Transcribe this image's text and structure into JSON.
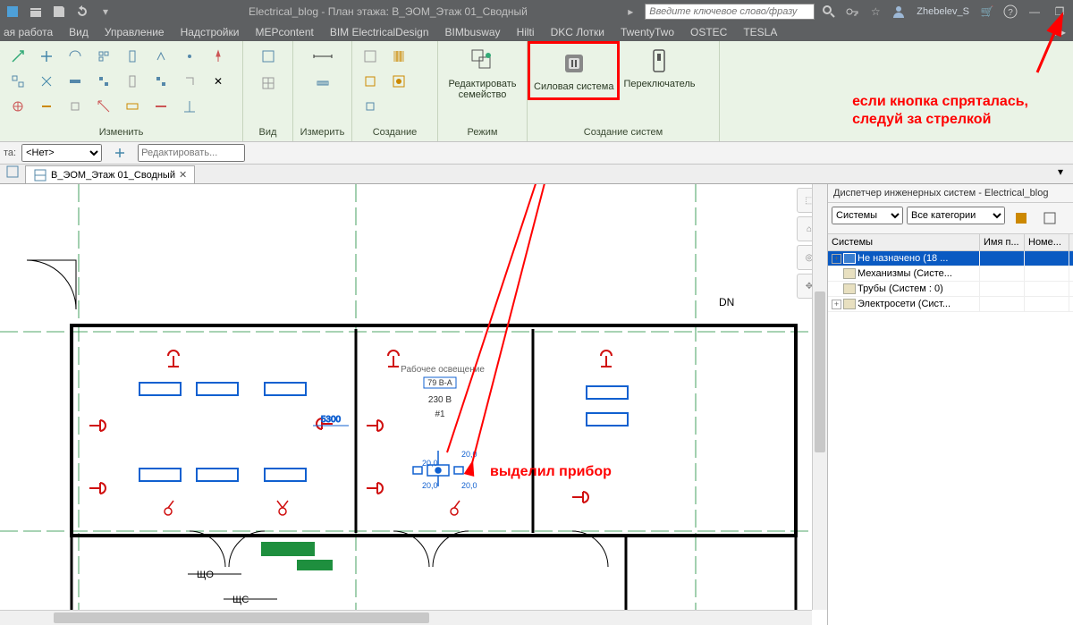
{
  "titlebar": {
    "title": "Electrical_blog - План этажа: В_ЭОМ_Этаж 01_Сводный",
    "search_placeholder": "Введите ключевое слово/фразу",
    "user": "Zhebelev_S"
  },
  "menu": {
    "items": [
      "ая работа",
      "Вид",
      "Управление",
      "Надстройки",
      "MEPcontent",
      "BIM ElectricalDesign",
      "BIMbusway",
      "Hilti",
      "DKC Лотки",
      "TwentyTwo",
      "OSTEC",
      "TESLA"
    ]
  },
  "ribbon": {
    "panels": {
      "modify": "Изменить",
      "view": "Вид",
      "measure": "Измерить",
      "create": "Создание",
      "mode": "Режим",
      "systems": "Создание систем"
    },
    "buttons": {
      "edit_family": "Редактировать\nсемейство",
      "power_system": "Силовая система",
      "switch": "Переключатель"
    }
  },
  "opt": {
    "label1": "та:",
    "select_value": "<Нет>",
    "placeholder": "Редактировать..."
  },
  "viewtab": {
    "name": "В_ЭОМ_Этаж 01_Сводный"
  },
  "canvas": {
    "room_label": "Рабочее освещение",
    "lbl_va": "79 В-А",
    "lbl_volt": "230 В",
    "lbl_num": "#1",
    "dim_5300": "5300",
    "val_200_a": "20,0",
    "val_200_b": "20,0",
    "val_200_c": "20,0",
    "val_200_d": "20,0",
    "lbl_dn": "DN",
    "lbl_sho": "ЩО",
    "lbl_shs": "ЩС"
  },
  "annotations": {
    "device": "выделил прибор",
    "hidden_btn": "если кнопка спряталась,\nследуй за стрелкой"
  },
  "browser": {
    "title": "Диспетчер инженерных систем - Electrical_blog",
    "dd1": "Системы",
    "dd2": "Все категории",
    "cols": {
      "c1": "Системы",
      "c2": "Имя п...",
      "c3": "Номе..."
    },
    "rows": [
      {
        "label": "Не назначено (18 ...",
        "selected": true,
        "expandable": true
      },
      {
        "label": "Механизмы (Систе...",
        "selected": false,
        "expandable": false
      },
      {
        "label": "Трубы (Систем : 0)",
        "selected": false,
        "expandable": false
      },
      {
        "label": "Электросети (Сист...",
        "selected": false,
        "expandable": true
      }
    ]
  }
}
